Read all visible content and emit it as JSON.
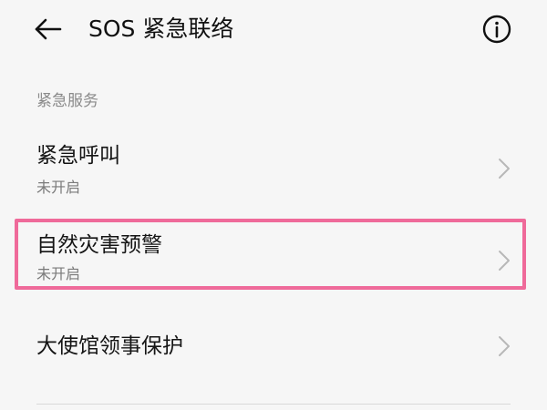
{
  "header": {
    "title": "SOS 紧急联络",
    "back_icon": "arrow-left-icon",
    "info_icon": "info-circle-icon"
  },
  "section": {
    "label": "紧急服务"
  },
  "items": [
    {
      "title": "紧急呼叫",
      "subtitle": "未开启",
      "chevron_icon": "chevron-right-icon"
    },
    {
      "title": "自然灾害预警",
      "subtitle": "未开启",
      "chevron_icon": "chevron-right-icon"
    },
    {
      "title": "大使馆领事保护",
      "subtitle": "",
      "chevron_icon": "chevron-right-icon"
    }
  ],
  "colors": {
    "background": "#f6f6f6",
    "highlight_border": "#ef6a9a",
    "secondary_text": "#7a7a7a"
  }
}
